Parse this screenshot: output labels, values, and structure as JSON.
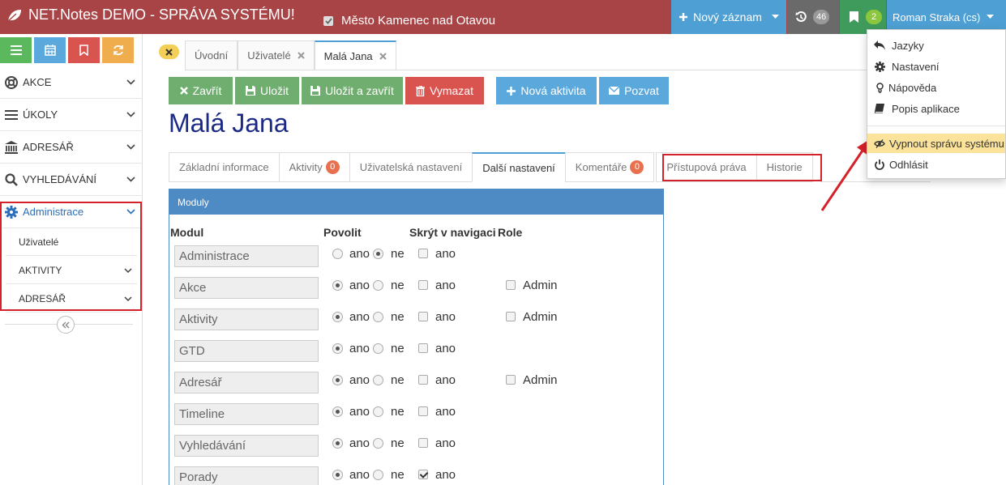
{
  "topbar": {
    "app_title": "NET.Notes DEMO - SPRÁVA SYSTÉMU!",
    "city_label": "Město Kamenec nad Otavou",
    "new_record_label": "Nový záznam",
    "history_count": "46",
    "bookmarks_count": "2",
    "user_label": "Roman Straka (cs)",
    "colors": {
      "bar": "#a94446",
      "blue": "#4e9fd3",
      "green": "#3f9b5c",
      "gray": "#6a6a6a"
    }
  },
  "sidebar": {
    "quick_buttons": [
      {
        "icon": "list-icon",
        "color": "#5cb85c"
      },
      {
        "icon": "calendar-icon",
        "color": "#5ba8dc"
      },
      {
        "icon": "bookmark-icon",
        "color": "#d9534f"
      },
      {
        "icon": "refresh-icon",
        "color": "#f0ad4e"
      }
    ],
    "items": [
      {
        "label": "AKCE",
        "icon": "lifebuoy-icon"
      },
      {
        "label": "ÚKOLY",
        "icon": "list-icon"
      },
      {
        "label": "ADRESÁŘ",
        "icon": "bank-icon"
      },
      {
        "label": "VYHLEDÁVÁNÍ",
        "icon": "search-icon"
      },
      {
        "label": "Administrace",
        "icon": "gear-icon"
      }
    ],
    "subitems": [
      {
        "label": "Uživatelé"
      },
      {
        "label": "AKTIVITY"
      },
      {
        "label": "ADRESÁŘ"
      }
    ]
  },
  "tabs": [
    {
      "label": "Úvodní"
    },
    {
      "label": "Uživatelé"
    },
    {
      "label": "Malá Jana"
    }
  ],
  "actions": {
    "close": "Zavřít",
    "save": "Uložit",
    "save_close": "Uložit a zavřít",
    "delete": "Vymazat",
    "new_activity": "Nová aktivita",
    "invite": "Pozvat"
  },
  "page_title": "Malá Jana",
  "detail_tabs": [
    {
      "label": "Základní informace",
      "badge": ""
    },
    {
      "label": "Aktivity",
      "badge": "0"
    },
    {
      "label": "Uživatelská nastavení",
      "badge": ""
    },
    {
      "label": "Další nastavení",
      "badge": ""
    },
    {
      "label": "Komentáře",
      "badge": "0"
    },
    {
      "label": "Přístupová práva",
      "badge": ""
    },
    {
      "label": "Historie",
      "badge": ""
    }
  ],
  "modules": {
    "panel_title": "Moduly",
    "headers": {
      "module": "Modul",
      "enable": "Povolit",
      "hide": "Skrýt v navigaci",
      "role": "Role"
    },
    "yes": "ano",
    "no": "ne",
    "rows": [
      {
        "name": "Administrace",
        "enabled": false,
        "hidden": false,
        "role": ""
      },
      {
        "name": "Akce",
        "enabled": true,
        "hidden": false,
        "role": "Admin"
      },
      {
        "name": "Aktivity",
        "enabled": true,
        "hidden": false,
        "role": "Admin"
      },
      {
        "name": "GTD",
        "enabled": true,
        "hidden": false,
        "role": ""
      },
      {
        "name": "Adresář",
        "enabled": true,
        "hidden": false,
        "role": "Admin"
      },
      {
        "name": "Timeline",
        "enabled": true,
        "hidden": false,
        "role": ""
      },
      {
        "name": "Vyhledávání",
        "enabled": true,
        "hidden": false,
        "role": ""
      },
      {
        "name": "Porady",
        "enabled": true,
        "hidden": true,
        "role": ""
      }
    ]
  },
  "user_menu": {
    "items": [
      {
        "label": "Jazyky",
        "icon": "reply-icon"
      },
      {
        "label": "Nastavení",
        "icon": "gear-icon"
      },
      {
        "label": "Nápověda",
        "icon": "lightbulb-icon"
      },
      {
        "label": "Popis aplikace",
        "icon": "book-icon"
      },
      {
        "label": "Vypnout správu systému",
        "icon": "eye-slash-icon",
        "highlighted": true
      },
      {
        "label": "Odhlásit",
        "icon": "power-icon"
      }
    ]
  }
}
